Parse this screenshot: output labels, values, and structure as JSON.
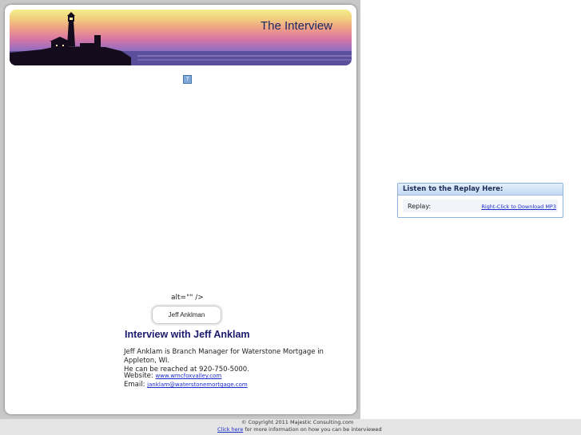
{
  "banner": {
    "title": "The Interview"
  },
  "photo": {
    "alt_leftover": "alt=\"\" />",
    "caption": "Jeff Anklman"
  },
  "article": {
    "heading": "Interview with Jeff Anklam",
    "bio_line1": "Jeff Anklam is Branch Manager for Waterstone Mortgage in Appleton, WI.",
    "bio_line2": "He can be reached at 920-750-5000.",
    "website_label": "Website:",
    "website_url": "www.wmcfoxvalley.com",
    "email_label": "Email:",
    "email_address": "janklam@waterstonemortgage.com"
  },
  "replay": {
    "header": "Listen to the Replay Here:",
    "label": "Replay:",
    "download_link": "Right-Click to Download MP3"
  },
  "footer": {
    "copyright": "© Copyright 2011 Majestic Consulting.com",
    "click_here": "Click here",
    "more_info": " for more information on how you can be interviewed"
  },
  "colors": {
    "heading": "#1a1a6e",
    "link": "#1a2ccc",
    "replay_border": "#8fb3e0"
  }
}
